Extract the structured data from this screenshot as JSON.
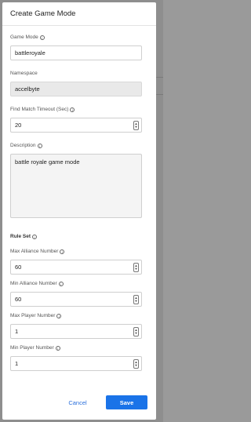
{
  "modal": {
    "title": "Create Game Mode"
  },
  "fields": {
    "game_mode": {
      "label": "Game Mode",
      "value": "battleroyale"
    },
    "namespace": {
      "label": "Namespace",
      "value": "accelbyte"
    },
    "find_match_timeout": {
      "label": "Find Match Timeout (Sec)",
      "value": "20"
    },
    "description": {
      "label": "Description",
      "value": "battle royale game mode"
    }
  },
  "rule_set": {
    "label": "Rule Set",
    "max_alliance": {
      "label": "Max Alliance Number",
      "value": "60"
    },
    "min_alliance": {
      "label": "Min Alliance Number",
      "value": "60"
    },
    "max_player": {
      "label": "Max Player Number",
      "value": "1"
    },
    "min_player": {
      "label": "Min Player Number",
      "value": "1"
    }
  },
  "footer": {
    "cancel_label": "Cancel",
    "save_label": "Save"
  },
  "icons": {
    "info": "info-icon",
    "stepper": "stepper-icon"
  },
  "colors": {
    "primary": "#1a73e8",
    "link": "#2a6fdb"
  }
}
